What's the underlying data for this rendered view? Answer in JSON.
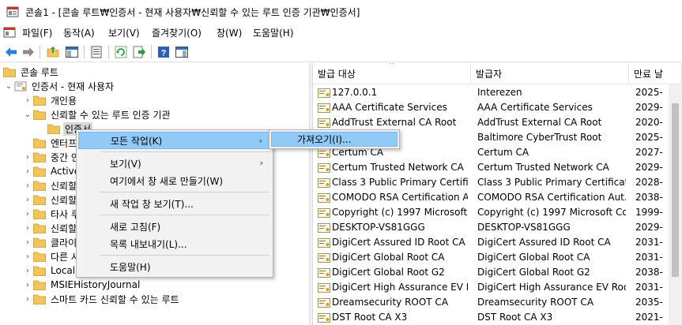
{
  "window": {
    "title": "콘솔1 - [콘솔 루트₩인증서 - 현재 사용자₩신뢰할 수 있는 루트 인증 기관₩인증서]"
  },
  "menubar": {
    "items": [
      {
        "label": "파일(F)"
      },
      {
        "label": "동작(A)"
      },
      {
        "label": "보기(V)"
      },
      {
        "label": "즐겨찾기(O)"
      },
      {
        "label": "창(W)"
      },
      {
        "label": "도움말(H)"
      }
    ]
  },
  "toolbar": {
    "buttons": [
      "back-arrow-icon",
      "forward-arrow-icon",
      "up-folder-icon",
      "show-hide-tree-icon",
      "properties-icon",
      "refresh-icon",
      "export-list-icon",
      "help-icon",
      "show-action-pane-icon"
    ]
  },
  "tree": {
    "items": [
      {
        "label": "콘솔 루트"
      },
      {
        "label": "인증서 - 현재 사용자"
      },
      {
        "label": "개인용"
      },
      {
        "label": "신뢰할 수 있는 루트 인증 기관"
      },
      {
        "label": "인증서"
      },
      {
        "label": "엔터프"
      },
      {
        "label": "중간 인"
      },
      {
        "label": "Active"
      },
      {
        "label": "신뢰할"
      },
      {
        "label": "신뢰할"
      },
      {
        "label": "타사 루"
      },
      {
        "label": "신뢰할"
      },
      {
        "label": "클라이"
      },
      {
        "label": "다른 사"
      },
      {
        "label": "Local N"
      },
      {
        "label": "MSIEHistoryJournal"
      },
      {
        "label": "스마트 카드 신뢰할 수 있는 루트"
      }
    ]
  },
  "list": {
    "columns": [
      {
        "label": "발급 대상"
      },
      {
        "label": "발급자"
      },
      {
        "label": "만료 날"
      }
    ],
    "rows": [
      {
        "issued_to": "127.0.0.1",
        "issued_by": "Interezen",
        "expires": "2025-"
      },
      {
        "issued_to": "AAA Certificate Services",
        "issued_by": "AAA Certificate Services",
        "expires": "2029-"
      },
      {
        "issued_to": "AddTrust External CA Root",
        "issued_by": "AddTrust External CA Root",
        "expires": "2020-"
      },
      {
        "issued_to": "erTrust Root",
        "issued_by": "Baltimore CyberTrust Root",
        "expires": "2025-"
      },
      {
        "issued_to": "Certum CA",
        "issued_by": "Certum CA",
        "expires": "2027-"
      },
      {
        "issued_to": "Certum Trusted Network CA",
        "issued_by": "Certum Trusted Network CA",
        "expires": "2029-"
      },
      {
        "issued_to": "Class 3 Public Primary Certific...",
        "issued_by": "Class 3 Public Primary Certificati...",
        "expires": "2028-"
      },
      {
        "issued_to": "COMODO RSA Certification A...",
        "issued_by": "COMODO RSA Certification Aut...",
        "expires": "2038-"
      },
      {
        "issued_to": "Copyright (c) 1997 Microsoft ...",
        "issued_by": "Copyright (c) 1997 Microsoft Co...",
        "expires": "1999-"
      },
      {
        "issued_to": "DESKTOP-VS81GGG",
        "issued_by": "DESKTOP-VS81GGG",
        "expires": "2029-"
      },
      {
        "issued_to": "DigiCert Assured ID Root CA",
        "issued_by": "DigiCert Assured ID Root CA",
        "expires": "2031-"
      },
      {
        "issued_to": "DigiCert Global Root CA",
        "issued_by": "DigiCert Global Root CA",
        "expires": "2031-"
      },
      {
        "issued_to": "DigiCert Global Root G2",
        "issued_by": "DigiCert Global Root G2",
        "expires": "2038-"
      },
      {
        "issued_to": "DigiCert High Assurance EV R...",
        "issued_by": "DigiCert High Assurance EV Root ...",
        "expires": "2031-"
      },
      {
        "issued_to": "Dreamsecurity ROOT CA",
        "issued_by": "Dreamsecurity ROOT CA",
        "expires": "2035-"
      },
      {
        "issued_to": "DST Root CA X3",
        "issued_by": "DST Root CA X3",
        "expires": "2021-"
      }
    ]
  },
  "context_menu": {
    "items": [
      {
        "label": "모든 작업(K)",
        "submenu": true
      },
      {
        "label": "보기(V)",
        "submenu": true
      },
      {
        "label": "여기에서 창 새로 만들기(W)"
      },
      {
        "label": "새 작업 창 보기(T)..."
      },
      {
        "label": "새로 고침(F)"
      },
      {
        "label": "목록 내보내기(L)..."
      },
      {
        "label": "도움말(H)"
      }
    ]
  },
  "submenu": {
    "items": [
      {
        "label": "가져오기(I)..."
      }
    ]
  },
  "colors": {
    "highlight": "#91c9f7",
    "folder": "#f2c55c",
    "selected": "#d9d9d9"
  }
}
